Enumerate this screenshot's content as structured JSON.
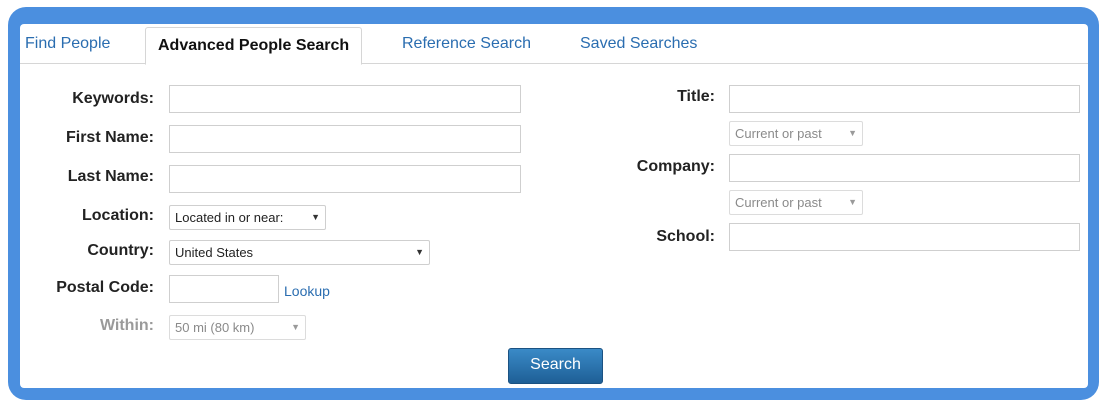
{
  "tabs": [
    {
      "label": "Find People"
    },
    {
      "label": "Advanced People Search"
    },
    {
      "label": "Reference Search"
    },
    {
      "label": "Saved Searches"
    }
  ],
  "active_tab": "Advanced People Search",
  "left": {
    "keywords": {
      "label": "Keywords:",
      "value": ""
    },
    "first_name": {
      "label": "First Name:",
      "value": ""
    },
    "last_name": {
      "label": "Last Name:",
      "value": ""
    },
    "location": {
      "label": "Location:",
      "selected": "Located in or near:"
    },
    "country": {
      "label": "Country:",
      "selected": "United States"
    },
    "postal_code": {
      "label": "Postal Code:",
      "value": "",
      "lookup": "Lookup"
    },
    "within": {
      "label": "Within:",
      "selected": "50 mi (80 km)"
    }
  },
  "right": {
    "title": {
      "label": "Title:",
      "value": "",
      "scope": "Current or past"
    },
    "company": {
      "label": "Company:",
      "value": "",
      "scope": "Current or past"
    },
    "school": {
      "label": "School:",
      "value": ""
    }
  },
  "search_button": "Search",
  "colors": {
    "frame": "#4b8fdf",
    "link": "#2a6db0",
    "button": "#2873b0"
  }
}
